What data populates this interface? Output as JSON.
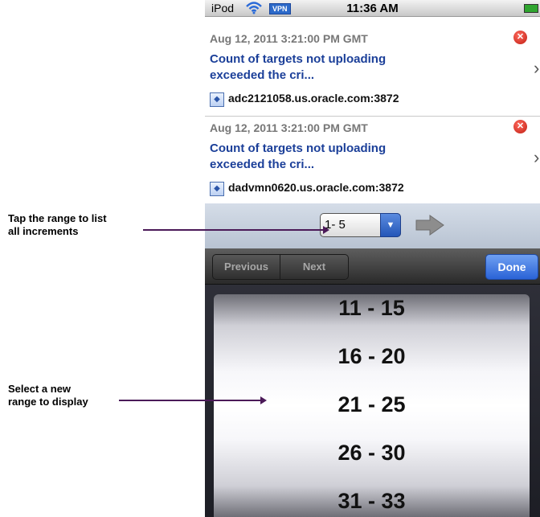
{
  "annotations": {
    "tap_range": [
      "Tap the range to list",
      "all increments"
    ],
    "select_range": [
      "Select a new",
      "range to display"
    ]
  },
  "status_bar": {
    "carrier": "iPod",
    "vpn": "VPN",
    "time": "11:36 AM"
  },
  "alerts": [
    {
      "timestamp": "Aug 12, 2011 3:21:00 PM GMT",
      "message": [
        "Count of targets not uploading",
        "exceeded the cri..."
      ],
      "host": "adc2121058.us.oracle.com:3872"
    },
    {
      "timestamp": "Aug 12, 2011 3:21:00 PM GMT",
      "message": [
        "Count of targets not uploading",
        "exceeded the cri..."
      ],
      "host": "dadvmn0620.us.oracle.com:3872"
    }
  ],
  "pager": {
    "range_value": "1- 5"
  },
  "toolbar": {
    "previous": "Previous",
    "next": "Next",
    "done": "Done"
  },
  "picker": {
    "items": [
      "11 - 15",
      "16 - 20",
      "21 - 25",
      "26 - 30",
      "31 - 33"
    ],
    "selected": "21 - 25"
  },
  "colors": {
    "alert_link": "#1b3f99",
    "done_button": "#2a63d6",
    "annotation_arrow": "#4b1a58",
    "error_icon": "#c01d12"
  },
  "icons": [
    "wifi-icon",
    "vpn-badge",
    "battery-icon",
    "error-icon",
    "chevron-right-icon",
    "host-icon",
    "dropdown-arrow-icon",
    "next-page-arrow-icon"
  ]
}
